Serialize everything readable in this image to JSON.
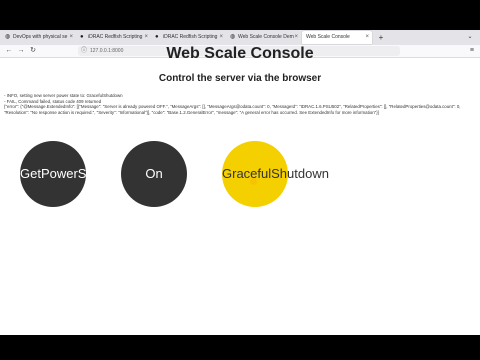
{
  "browser": {
    "tabs": [
      {
        "label": "DevOps with physical se",
        "icon": "globe",
        "active": false
      },
      {
        "label": "iDRAC Redfish Scripting",
        "icon": "github",
        "active": false
      },
      {
        "label": "iDRAC Redfish Scripting",
        "icon": "github",
        "active": false
      },
      {
        "label": "Web Scale Console Dem",
        "icon": "globe",
        "active": false
      },
      {
        "label": "Web Scale Console",
        "icon": "",
        "active": true
      }
    ],
    "new_tab_symbol": "+",
    "url": "127.0.0.1:8000"
  },
  "page": {
    "title": "Web Scale Console",
    "subtitle": "Control the server via the browser",
    "log_lines": [
      "- INFO, setting new server power state to: GracefulShutdown",
      "- FAIL, Command failed, status code 409 returned",
      "{\"error\": {\"@Message.ExtendedInfo\": [{\"Message\": \"Server is already powered OFF.\", \"MessageArgs\": [], \"MessageArgs@odata.count\": 0, \"MessageId\": \"IDRAC.1.6.PSU502\", \"RelatedProperties\": [], \"RelatedProperties@odata.count\": 0, \"Resolution\": \"No response action is required.\", \"Severity\": \"Informational\"}], \"code\": \"Base.1.2.GeneralError\", \"message\": \"A general error has occurred. See ExtendedInfo for more information\"}}"
    ],
    "buttons": {
      "get_power": "GetPowerS",
      "on": "On",
      "graceful": "GracefulShutdown"
    }
  },
  "colors": {
    "button_dark": "#333333",
    "button_active": "#f4d000"
  }
}
